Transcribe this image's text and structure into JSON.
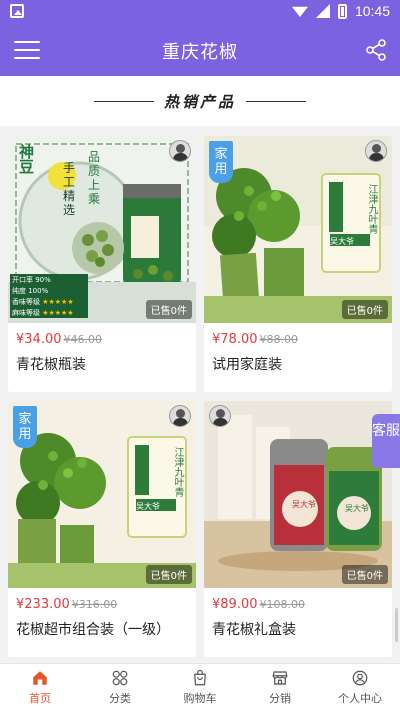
{
  "status_bar": {
    "time": "10:45"
  },
  "app_bar": {
    "title": "重庆花椒"
  },
  "section": {
    "title": "热销产品"
  },
  "products": [
    {
      "price": "¥34.00",
      "old_price": "¥46.00",
      "name": "青花椒瓶装",
      "sold": "已售0件",
      "label_a": "手工精选",
      "label_b": "品质上乘",
      "spec_1": "开口率 90%",
      "spec_2": "纯度 100%",
      "spec_3": "香味等级",
      "spec_4": "麻味等级",
      "logo": "神豆",
      "stars": 5
    },
    {
      "price": "¥78.00",
      "old_price": "¥88.00",
      "name": "试用家庭装",
      "sold": "已售0件",
      "badge": "家用",
      "tag_a": "江津九叶青",
      "tag_b": "吴大爷"
    },
    {
      "price": "¥233.00",
      "old_price": "¥316.00",
      "name": "花椒超市组合装（一级）",
      "sold": "已售0件",
      "badge": "家用",
      "tag_a": "江津九叶青",
      "tag_b": "吴大爷"
    },
    {
      "price": "¥89.00",
      "old_price": "¥108.00",
      "name": "青花椒礼盒装",
      "sold": "已售0件",
      "tag_a": "吴大爷",
      "tag_b": "吴大爷"
    }
  ],
  "side_button": {
    "label": "客服"
  },
  "tab_bar": {
    "tabs": [
      {
        "label": "首页",
        "icon": "home-icon",
        "active": true
      },
      {
        "label": "分类",
        "icon": "category-icon"
      },
      {
        "label": "购物车",
        "icon": "cart-icon"
      },
      {
        "label": "分销",
        "icon": "shop-icon"
      },
      {
        "label": "个人中心",
        "icon": "user-icon"
      }
    ]
  },
  "colors": {
    "primary": "#7a62e0",
    "price": "#e4393c",
    "active_tab": "#e4572e",
    "badge": "#4aa0e6",
    "service_button": "#8a78e6"
  }
}
